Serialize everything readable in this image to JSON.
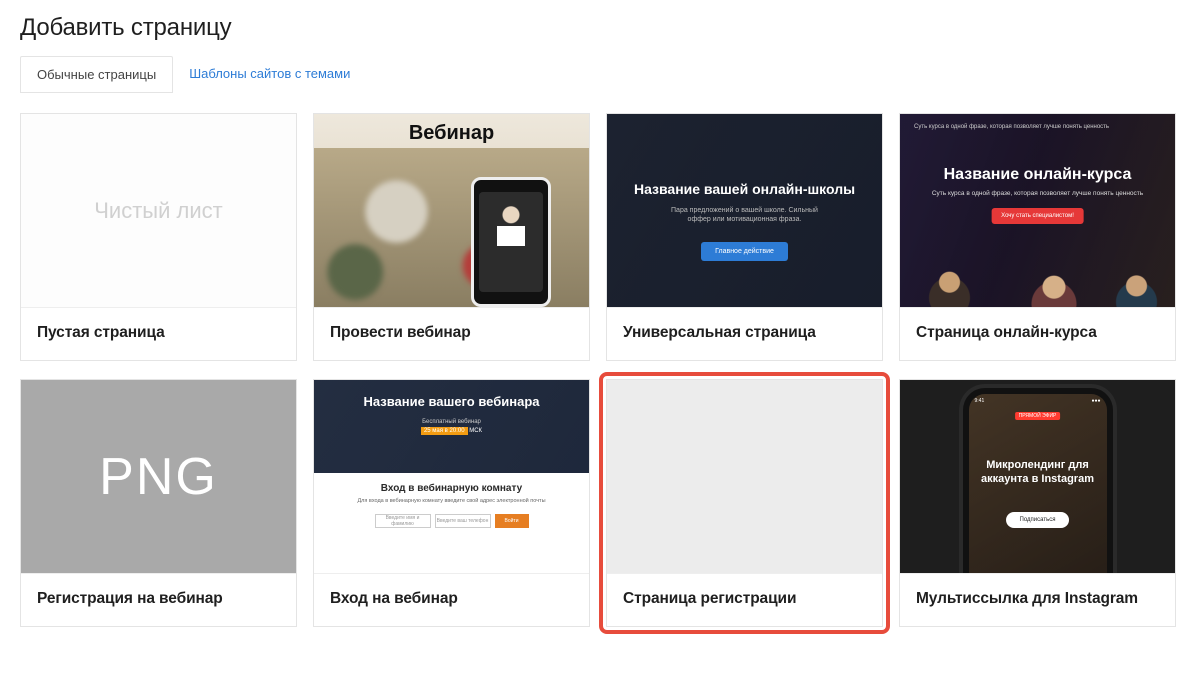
{
  "page": {
    "title": "Добавить страницу"
  },
  "tabs": {
    "regular": "Обычные страницы",
    "themed": "Шаблоны сайтов с темами"
  },
  "cards": [
    {
      "label": "Пустая страница",
      "preview": {
        "type": "blank",
        "text": "Чистый лист"
      }
    },
    {
      "label": "Провести вебинар",
      "preview": {
        "type": "webinar",
        "title": "Вебинар"
      }
    },
    {
      "label": "Универсальная страница",
      "preview": {
        "type": "dark",
        "title": "Название вашей онлайн-школы",
        "sub": "Пара предложений о вашей школе. Сильный оффер или мотивационная фраза.",
        "btn": "Главное действие"
      }
    },
    {
      "label": "Страница онлайн-курса",
      "preview": {
        "type": "course",
        "tiny": "Суть курса в одной фразе, которая позволяет лучше понять ценность",
        "title": "Название онлайн-курса",
        "sub": "Суть курса в одной фразе, которая позволяет лучше понять ценность",
        "btn": "Хочу стать специалистом!"
      }
    },
    {
      "label": "Регистрация на вебинар",
      "preview": {
        "type": "png",
        "text": "PNG"
      }
    },
    {
      "label": "Вход на вебинар",
      "preview": {
        "type": "wreg",
        "t1": "Название вашего вебинара",
        "t2": "Бесплатный вебинар",
        "t3a": "25 мая в 20:00",
        "t3b": "МСК",
        "b1": "Вход в вебинарную комнату",
        "b2": "Для входа в вебинарную комнату введите свой адрес электронной почты",
        "f1": "Введите имя и фамилию",
        "f2": "Введите ваш телефон",
        "f3": "Войти"
      }
    },
    {
      "label": "Страница регистрации",
      "highlight": true,
      "preview": {
        "type": "reg"
      }
    },
    {
      "label": "Мультиссылка для Instagram",
      "preview": {
        "type": "ig",
        "time": "9:41",
        "bat": "●●●",
        "rec": "ПРЯМОЙ ЭФИР",
        "title": "Микролендинг для аккаунта в Instagram",
        "btn": "Подписаться"
      }
    }
  ]
}
